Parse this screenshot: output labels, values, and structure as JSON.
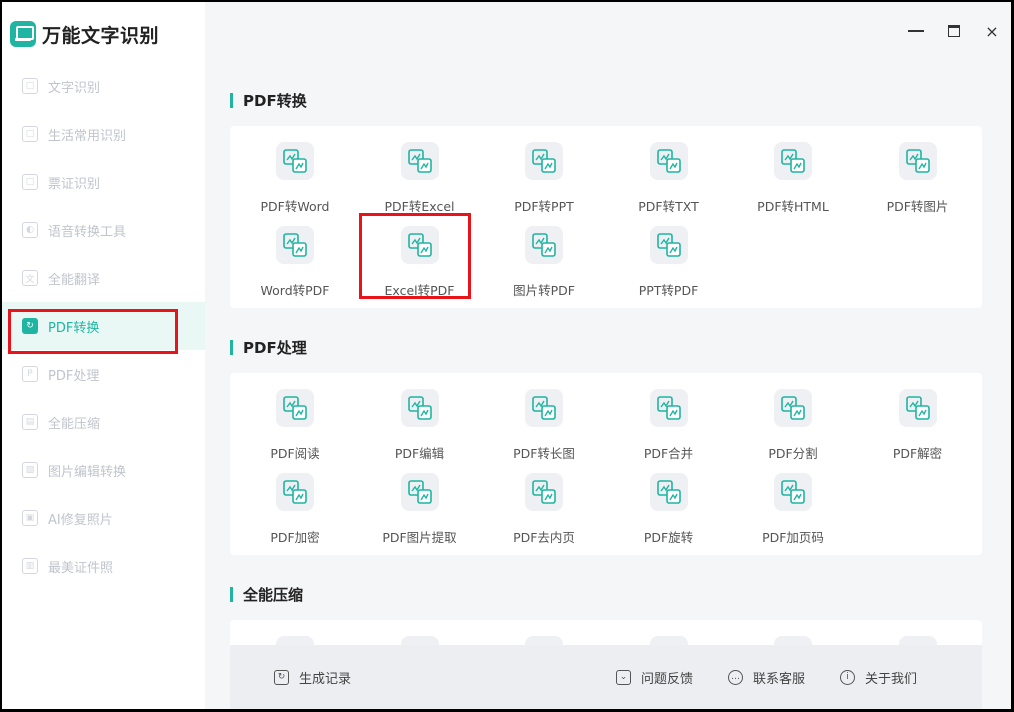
{
  "app": {
    "title": "万能文字识别"
  },
  "window_controls": {
    "minimize": "minimize",
    "maximize": "maximize",
    "close": "×"
  },
  "sidebar": {
    "items": [
      {
        "label": "文字识别",
        "active": false
      },
      {
        "label": "生活常用识别",
        "active": false
      },
      {
        "label": "票证识别",
        "active": false
      },
      {
        "label": "语音转换工具",
        "active": false
      },
      {
        "label": "全能翻译",
        "active": false
      },
      {
        "label": "PDF转换",
        "active": true
      },
      {
        "label": "PDF处理",
        "active": false
      },
      {
        "label": "全能压缩",
        "active": false
      },
      {
        "label": "图片编辑转换",
        "active": false
      },
      {
        "label": "AI修复照片",
        "active": false
      },
      {
        "label": "最美证件照",
        "active": false
      }
    ]
  },
  "sections": [
    {
      "title": "PDF转换",
      "tools": [
        {
          "label": "PDF转Word"
        },
        {
          "label": "PDF转Excel"
        },
        {
          "label": "PDF转PPT"
        },
        {
          "label": "PDF转TXT"
        },
        {
          "label": "PDF转HTML"
        },
        {
          "label": "PDF转图片"
        },
        {
          "label": "Word转PDF"
        },
        {
          "label": "Excel转PDF"
        },
        {
          "label": "图片转PDF"
        },
        {
          "label": "PPT转PDF"
        }
      ]
    },
    {
      "title": "PDF处理",
      "tools": [
        {
          "label": "PDF阅读"
        },
        {
          "label": "PDF编辑"
        },
        {
          "label": "PDF转长图"
        },
        {
          "label": "PDF合并"
        },
        {
          "label": "PDF分割"
        },
        {
          "label": "PDF解密"
        },
        {
          "label": "PDF加密"
        },
        {
          "label": "PDF图片提取"
        },
        {
          "label": "PDF去内页"
        },
        {
          "label": "PDF旋转"
        },
        {
          "label": "PDF加页码"
        }
      ]
    },
    {
      "title": "全能压缩",
      "tools": []
    }
  ],
  "bottombar": {
    "history": "生成记录",
    "feedback": "问题反馈",
    "support": "联系客服",
    "about": "关于我们"
  },
  "colors": {
    "accent": "#1fb5a2",
    "highlight": "#e8141a"
  }
}
